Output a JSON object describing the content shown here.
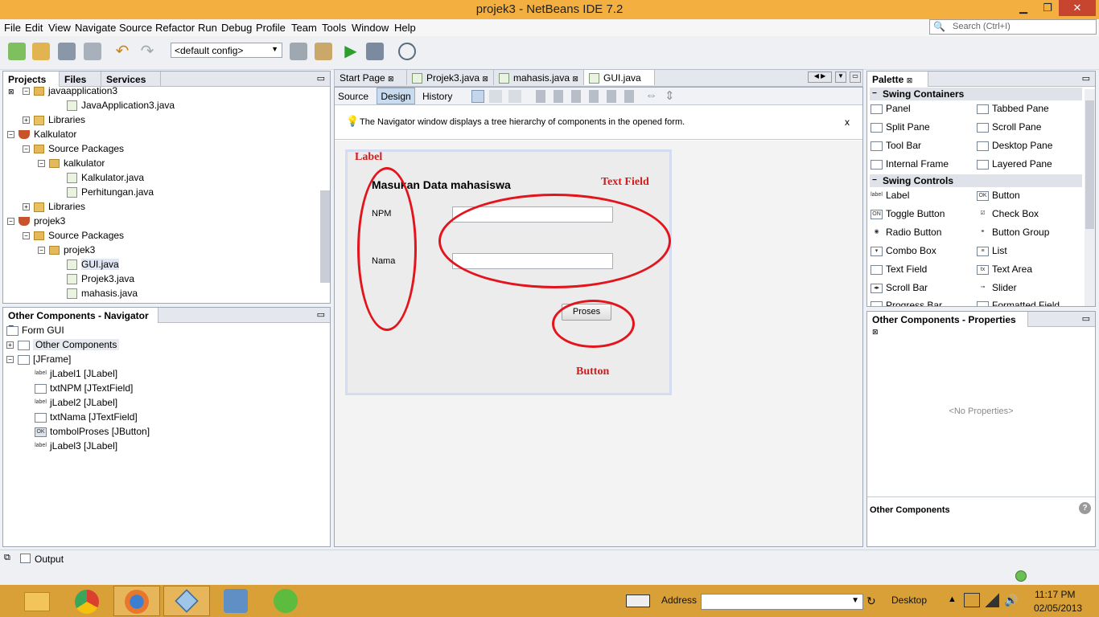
{
  "window": {
    "title": "projek3 - NetBeans IDE 7.2",
    "min": "▁",
    "max": "❐",
    "close": "✕"
  },
  "menu": [
    "File",
    "Edit",
    "View",
    "Navigate",
    "Source",
    "Refactor",
    "Run",
    "Debug",
    "Profile",
    "Team",
    "Tools",
    "Window",
    "Help"
  ],
  "search": {
    "placeholder": "Search (Ctrl+I)"
  },
  "toolbar": {
    "config": "<default config>"
  },
  "projects": {
    "tabs": [
      "Projects",
      "Files",
      "Services"
    ],
    "items": [
      {
        "label": "javaapplication3",
        "type": "pkg"
      },
      {
        "label": "JavaApplication3.java",
        "type": "java"
      },
      {
        "label": "Libraries",
        "type": "lib"
      },
      {
        "label": "Kalkulator",
        "type": "project"
      },
      {
        "label": "Source Packages",
        "type": "pkg"
      },
      {
        "label": "kalkulator",
        "type": "pkg"
      },
      {
        "label": "Kalkulator.java",
        "type": "java"
      },
      {
        "label": "Perhitungan.java",
        "type": "java"
      },
      {
        "label": "Libraries",
        "type": "lib"
      },
      {
        "label": "projek3",
        "type": "project"
      },
      {
        "label": "Source Packages",
        "type": "pkg"
      },
      {
        "label": "projek3",
        "type": "pkg"
      },
      {
        "label": "GUI.java",
        "type": "java"
      },
      {
        "label": "Projek3.java",
        "type": "java"
      },
      {
        "label": "mahasis.java",
        "type": "java"
      }
    ]
  },
  "navigator": {
    "title": "Other Components - Navigator",
    "items": [
      {
        "label": "Form GUI",
        "icon": "form"
      },
      {
        "label": "Other Components",
        "icon": "other"
      },
      {
        "label": "[JFrame]",
        "icon": "frame"
      },
      {
        "label": "jLabel1 [JLabel]",
        "icon": "label"
      },
      {
        "label": "txtNPM [JTextField]",
        "icon": "field"
      },
      {
        "label": "jLabel2 [JLabel]",
        "icon": "label"
      },
      {
        "label": "txtNama [JTextField]",
        "icon": "field"
      },
      {
        "label": "tombolProses [JButton]",
        "icon": "ok"
      },
      {
        "label": "jLabel3 [JLabel]",
        "icon": "label"
      }
    ]
  },
  "editor": {
    "tabs": [
      "Start Page",
      "Projek3.java",
      "mahasis.java",
      "GUI.java"
    ],
    "subtabs": [
      "Source",
      "Design",
      "History"
    ],
    "info": "The Navigator window displays a tree hierarchy of components in the opened form.",
    "info_close": "x",
    "form": {
      "title": "Masukan Data mahasiswa",
      "npm": "NPM",
      "nama": "Nama",
      "button": "Proses"
    }
  },
  "annotations": {
    "label": "Label",
    "textfield": "Text Field",
    "button": "Button"
  },
  "palette": {
    "title": "Palette",
    "containers_header": "Swing Containers",
    "containers": [
      "Panel",
      "Tabbed Pane",
      "Split Pane",
      "Scroll Pane",
      "Tool Bar",
      "Desktop Pane",
      "Internal Frame",
      "Layered Pane"
    ],
    "controls_header": "Swing Controls",
    "controls": [
      "Label",
      "Button",
      "Toggle Button",
      "Check Box",
      "Radio Button",
      "Button Group",
      "Combo Box",
      "List",
      "Text Field",
      "Text Area",
      "Scroll Bar",
      "Slider",
      "Progress Bar",
      "Formatted Field"
    ]
  },
  "properties": {
    "title": "Other Components - Properties",
    "empty": "<No Properties>",
    "footer": "Other Components",
    "help": "?"
  },
  "output": {
    "label": "Output"
  },
  "taskbar": {
    "address": "Address",
    "desktop": "Desktop",
    "time": "11:17 PM",
    "date": "02/05/2013"
  }
}
